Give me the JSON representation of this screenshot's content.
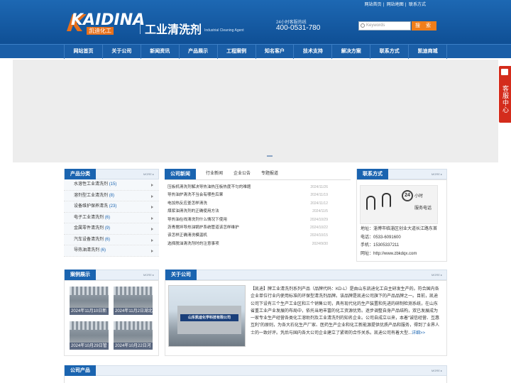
{
  "toplinks": [
    "网站首页",
    "网站地图",
    "联系方式"
  ],
  "logo": {
    "text": "KAIDINA",
    "sub": "凯迪化工"
  },
  "brand": {
    "cn": "工业清洗剂",
    "en": "Industrial Cleaning Agent"
  },
  "hotline": {
    "label": "24小时客服热线",
    "number": "400-0531-780"
  },
  "search": {
    "placeholder": "Keywords",
    "button": "搜 索"
  },
  "nav": [
    "网站首页",
    "关于公司",
    "新闻资讯",
    "产品展示",
    "工程案例",
    "知名客户",
    "技术支持",
    "解决方案",
    "联系方式",
    "凯迪商城"
  ],
  "service": "客服中心",
  "categories": {
    "title": "产品分类",
    "more": "MORE ▸",
    "items": [
      {
        "name": "水溶性工业清洗剂",
        "count": "(15)"
      },
      {
        "name": "溶剂型工业清洗剂",
        "count": "(8)"
      },
      {
        "name": "设备维护保养清洗",
        "count": "(23)"
      },
      {
        "name": "电子工业清洗剂",
        "count": "(6)"
      },
      {
        "name": "金属零件清洗剂",
        "count": "(9)"
      },
      {
        "name": "汽车设备清洗剂",
        "count": "(6)"
      },
      {
        "name": "导热油清洗剂",
        "count": "(6)"
      }
    ]
  },
  "news": {
    "tabs": [
      "公司新闻",
      "行业新闻",
      "企业公告",
      "专题报道"
    ],
    "items": [
      {
        "title": "压板机清洗剂解决导热油热压板热度不匀的难题",
        "date": "2024/11/26"
      },
      {
        "title": "导热油炉清洗不当会有哪些后果",
        "date": "2024/11/19"
      },
      {
        "title": "电加热反应釜怎样清洗",
        "date": "2024/11/12"
      },
      {
        "title": "煤浆油清洗剂的正确使用方法",
        "date": "2024/11/5"
      },
      {
        "title": "导热油在线清洗剂什么情况下使用",
        "date": "2024/10/29"
      },
      {
        "title": "沥青搅拌导热油锅炉系统管道该怎样维护",
        "date": "2024/10/22"
      },
      {
        "title": "该怎样正确清洗模温机",
        "date": "2024/10/15"
      },
      {
        "title": "选择脱油清洗剂时的注意事项",
        "date": "2024/9/30"
      }
    ]
  },
  "contact": {
    "title": "联系方式",
    "more": "MORE ▸",
    "badge": "24",
    "hours": "小时",
    "service_phone": "服务电话",
    "address": "地址：淄博市临淄区创业大道长江路东首",
    "phone": "电话：0533-6091600",
    "mobile": "手机：15305337211",
    "website": "网址：http://www.zbkdqx.com"
  },
  "cases": {
    "title": "案例展示",
    "more": "MORE ▸",
    "items": [
      "2024年11月10日新",
      "2024年11月2日湖北",
      "2024年10月29日管",
      "2024年10月22日河"
    ]
  },
  "about": {
    "title": "关于公司",
    "more": "MORE ▸",
    "sign": "山东凯迪化学科技有限公司",
    "text": "【凯迪】牌工业清洗剂系列产品（品牌代码：KD-L）是由山东凯迪化工自主研发生产的。符合国内各企业单位行业内使用标准的环保型清洗剂品牌。该品牌是凯迪公司旗下的产品品牌之一。目前，凯迪公司下设有三个生产工业区和三个销售公司，具有现代化的生产装置和先进的研制检测系统，在山东省重工业产业发展的布局中，依托当地丰富的化工资源优势。逐步调整自身产品结构，双已发展成为一家专业生产经营各类化工溶助剂及工业清洗剂的知名企业。公司自成立以来，本着“诚信经营、互惠互利”的原则，为各大石化生产厂家、医药生产企业和化工新能源提供优质产品和服务，得到了业界人士的一致好评。凭后与国内各大公司企业建立了紧密的合作关系。凯迪公司有着大型...",
    "more_link": "详细>>"
  },
  "products": {
    "title": "公司产品",
    "more": "MORE ▸"
  }
}
